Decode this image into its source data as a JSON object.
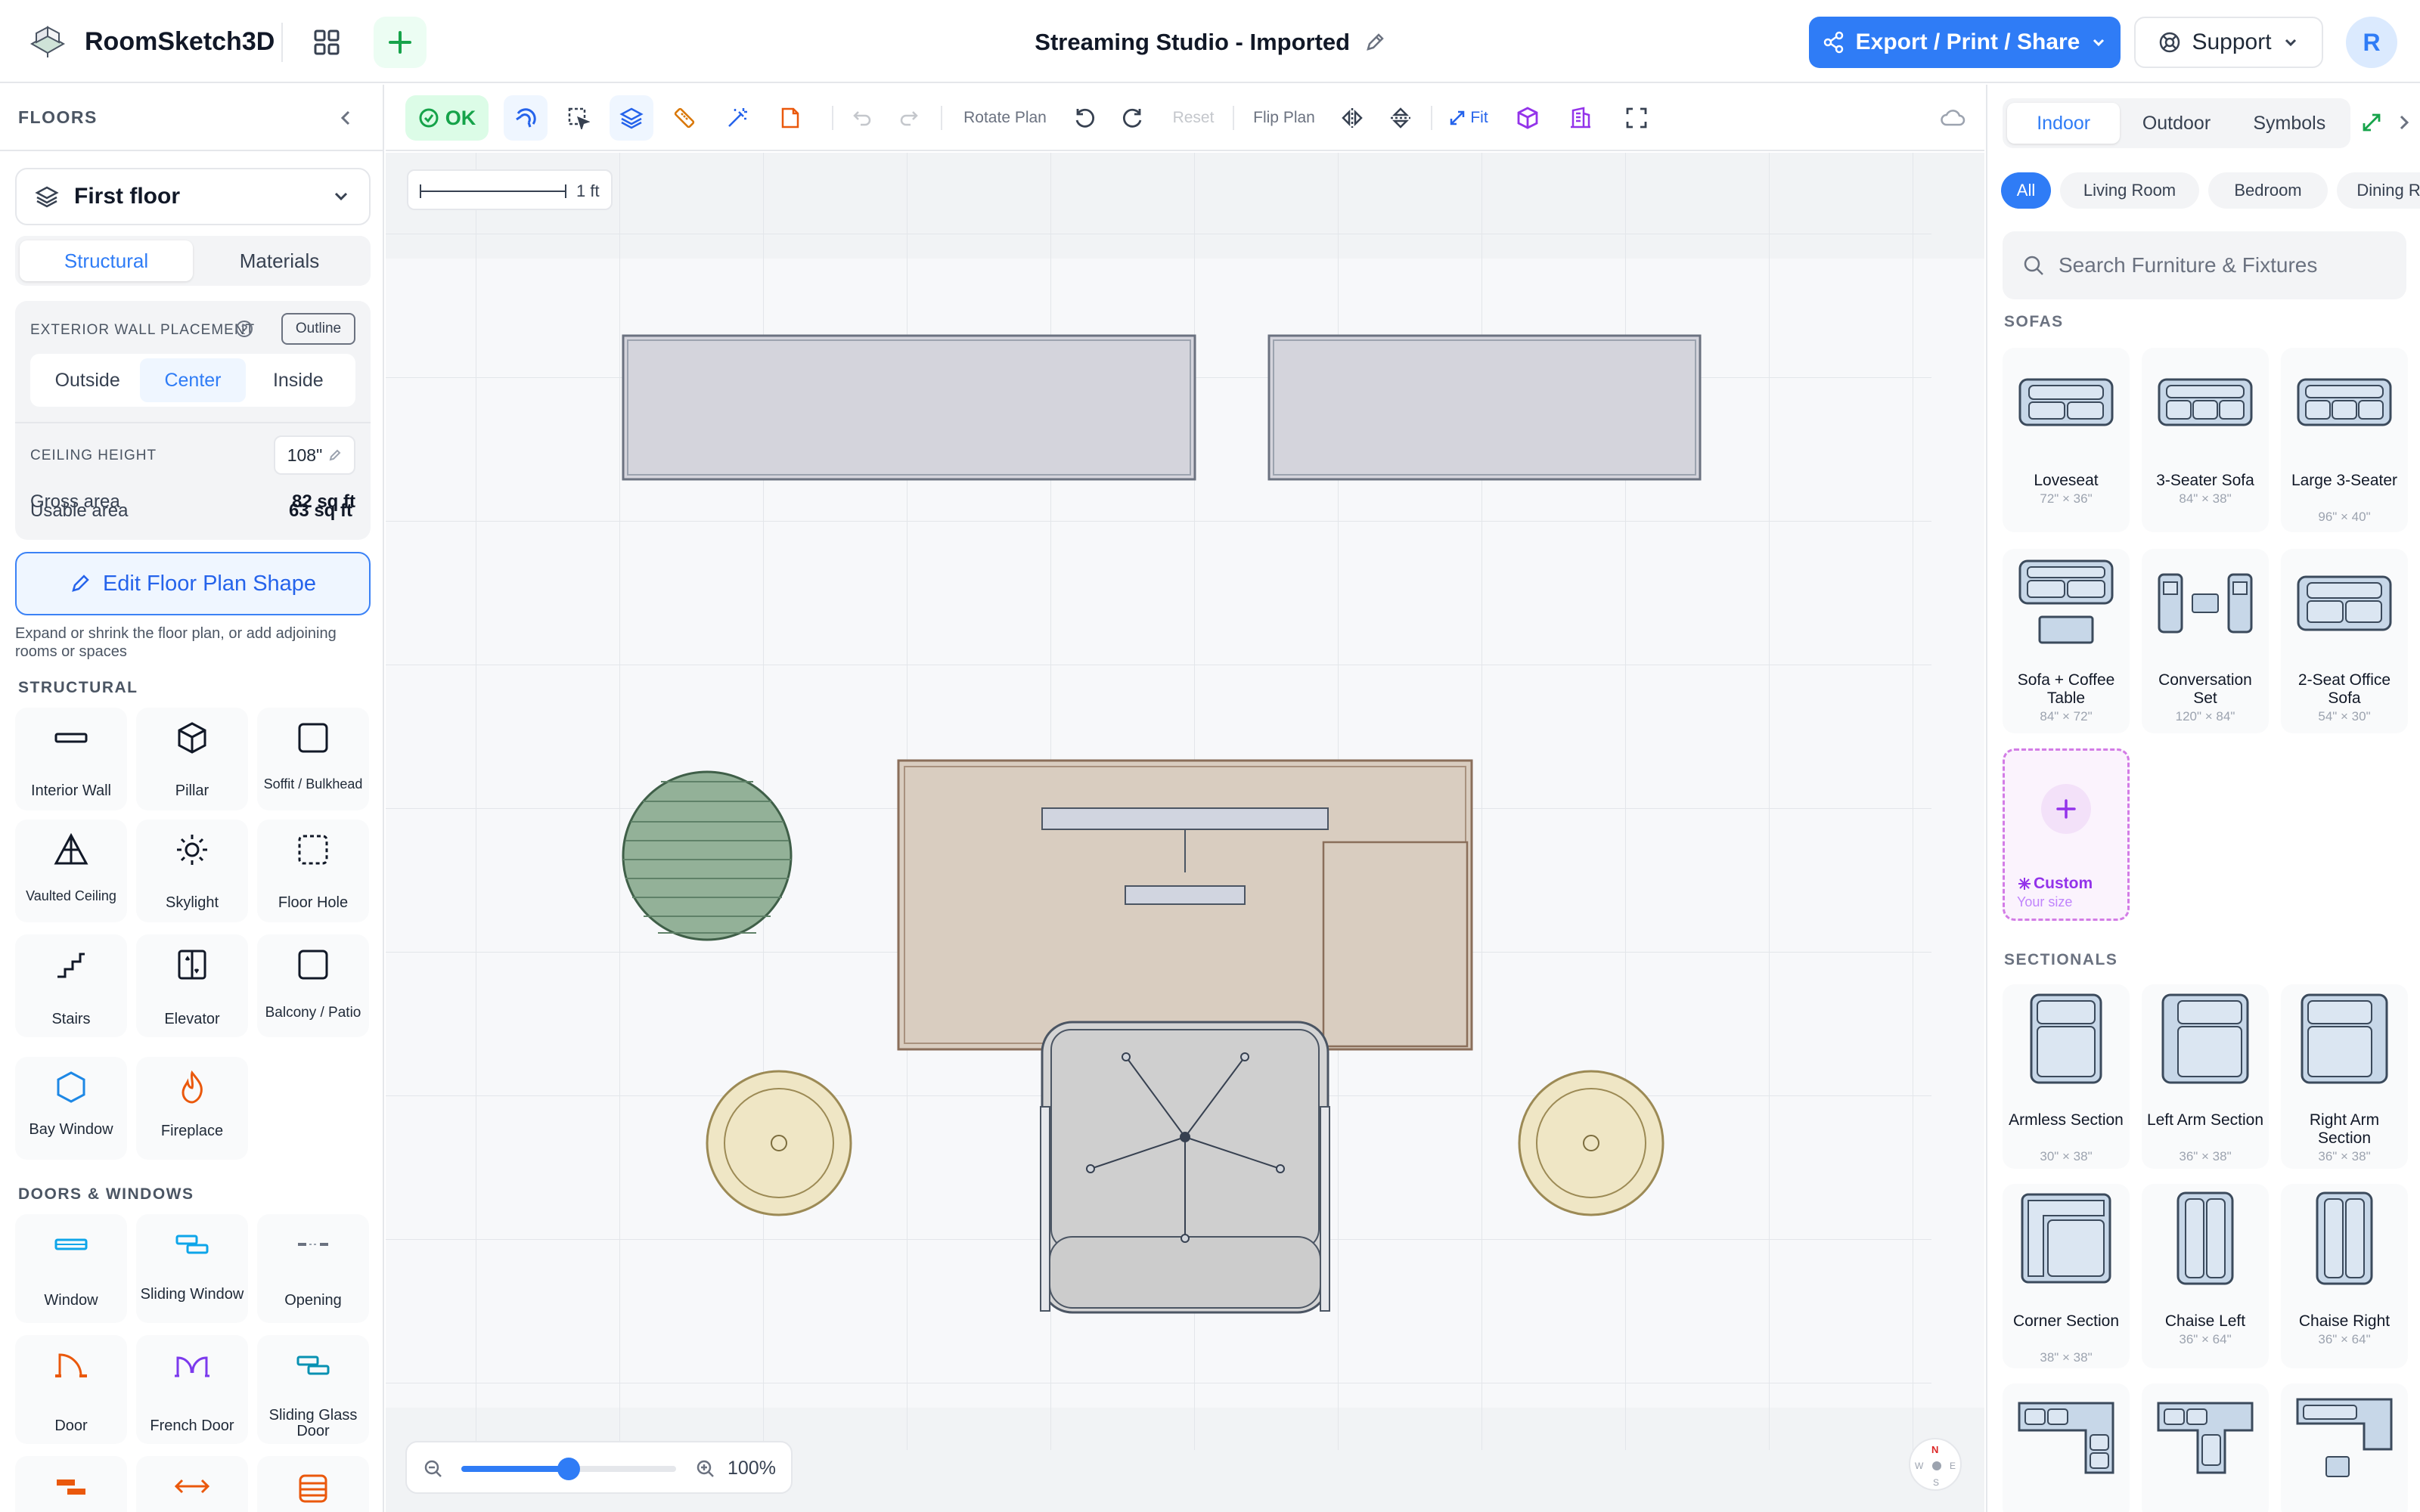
{
  "header": {
    "app_name": "RoomSketch3D",
    "document_title": "Streaming Studio - Imported",
    "export_label": "Export / Print / Share",
    "support_label": "Support",
    "avatar_initial": "R"
  },
  "toolbar": {
    "ok_label": "OK",
    "rotate_label": "Rotate Plan",
    "reset_label": "Reset",
    "flip_label": "Flip Plan",
    "fit_label": "Fit"
  },
  "canvas": {
    "scale_label": "1 ft",
    "zoom_level": "100%",
    "zoom_value": 50,
    "compass": {
      "n": "N",
      "e": "E",
      "s": "S",
      "w": "W"
    }
  },
  "floors": {
    "heading": "FLOORS",
    "current_floor": "First floor",
    "tabs": [
      "Structural",
      "Materials"
    ],
    "active_tab": "Structural",
    "wall_placement_label": "EXTERIOR WALL PLACEMENT",
    "outline_label": "Outline",
    "wall_options": [
      "Outside",
      "Center",
      "Inside"
    ],
    "active_wall_option": "Center",
    "ceiling_label": "CEILING HEIGHT",
    "ceiling_value": "108\"",
    "gross_label": "Gross area",
    "gross_value": "82 sq ft",
    "usable_label": "Usable area",
    "usable_value": "63 sq ft",
    "edit_button": "Edit Floor Plan Shape",
    "edit_help": "Expand or shrink the floor plan, or add adjoining rooms or spaces"
  },
  "structural": {
    "heading": "STRUCTURAL",
    "items": [
      "Interior Wall",
      "Pillar",
      "Soffit / Bulkhead",
      "Vaulted Ceiling",
      "Skylight",
      "Floor Hole",
      "Stairs",
      "Elevator",
      "Balcony / Patio",
      "Bay Window",
      "Fireplace"
    ]
  },
  "doors_windows": {
    "heading": "DOORS & WINDOWS",
    "items": [
      "Window",
      "Sliding Window",
      "Opening",
      "Door",
      "French Door",
      "Sliding Glass Door"
    ]
  },
  "library": {
    "tabs": [
      "Indoor",
      "Outdoor",
      "Symbols"
    ],
    "active_tab": "Indoor",
    "chips": [
      "All",
      "Living Room",
      "Bedroom",
      "Dining Room"
    ],
    "active_chip": "All",
    "search_placeholder": "Search Furniture & Fixtures",
    "sofas_heading": "SOFAS",
    "sofas": [
      {
        "name": "Loveseat",
        "dims": "72\" × 36\""
      },
      {
        "name": "3-Seater Sofa",
        "dims": "84\" × 38\""
      },
      {
        "name": "Large 3-Seater",
        "dims": "96\" × 40\""
      },
      {
        "name": "Sofa + Coffee Table",
        "dims": "84\" × 72\""
      },
      {
        "name": "Conversation Set",
        "dims": "120\" × 84\""
      },
      {
        "name": "2-Seat Office Sofa",
        "dims": "54\" × 30\""
      }
    ],
    "custom_name": "Custom",
    "custom_sub": "Your size",
    "sectionals_heading": "SECTIONALS",
    "sectionals": [
      {
        "name": "Armless Section",
        "dims": "30\" × 38\""
      },
      {
        "name": "Left Arm Section",
        "dims": "36\" × 38\""
      },
      {
        "name": "Right Arm Section",
        "dims": "36\" × 38\""
      },
      {
        "name": "Corner Section",
        "dims": "38\" × 38\""
      },
      {
        "name": "Chaise Left",
        "dims": "36\" × 64\""
      },
      {
        "name": "Chaise Right",
        "dims": "36\" × 64\""
      }
    ]
  },
  "colors": {
    "accent": "#2f7cf6",
    "ok_green": "#16a34a",
    "desk": "#d9cdc0",
    "rug": "#93b198",
    "lamp": "#efe6c5"
  }
}
